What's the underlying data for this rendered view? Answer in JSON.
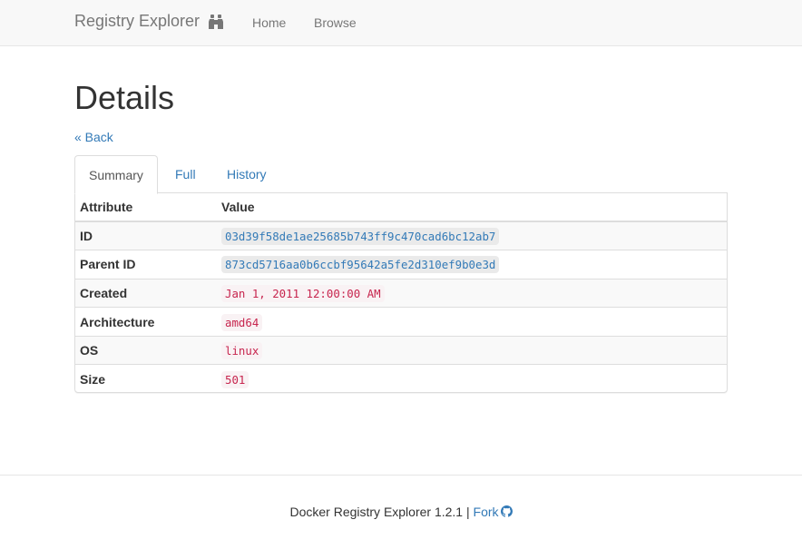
{
  "navbar": {
    "brand": "Registry Explorer",
    "brand_icon": "binoculars-icon",
    "links": [
      "Home",
      "Browse"
    ]
  },
  "page": {
    "title": "Details",
    "back": "« Back"
  },
  "tabs": [
    "Summary",
    "Full",
    "History"
  ],
  "active_tab": "Summary",
  "table": {
    "headers": [
      "Attribute",
      "Value"
    ],
    "rows": [
      {
        "attr": "ID",
        "value": "03d39f58de1ae25685b743ff9c470cad6bc12ab7"
      },
      {
        "attr": "Parent ID",
        "value": "873cd5716aa0b6ccbf95642a5fe2d310ef9b0e3d"
      },
      {
        "attr": "Created",
        "value": "Jan 1, 2011 12:00:00 AM"
      },
      {
        "attr": "Architecture",
        "value": "amd64"
      },
      {
        "attr": "OS",
        "value": "linux"
      },
      {
        "attr": "Size",
        "value": "501"
      }
    ]
  },
  "footer": {
    "text": "Docker Registry Explorer 1.2.1",
    "separator": "|",
    "fork": "Fork",
    "fork_icon": "github-icon"
  },
  "colors": {
    "link": "#337ab7",
    "code_text": "#c7254e",
    "code_bg": "#f9f2f4",
    "navbar_bg": "#f8f8f8"
  }
}
